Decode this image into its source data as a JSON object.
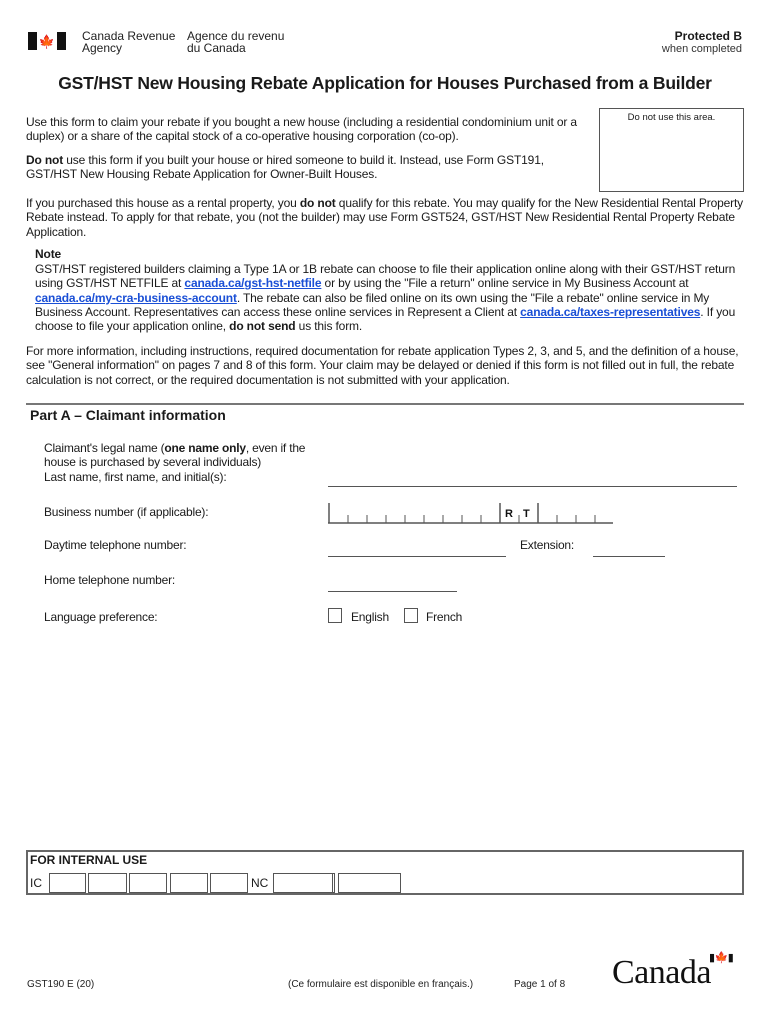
{
  "header": {
    "agency_en_line1": "Canada Revenue",
    "agency_en_line2": "Agency",
    "agency_fr_line1": "Agence du revenu",
    "agency_fr_line2": "du Canada",
    "flag_icon": "canada-flag-icon",
    "protected_label": "Protected B",
    "protected_sub": "when completed"
  },
  "title": "GST/HST New Housing Rebate Application for Houses Purchased from a Builder",
  "do_not_use_area": "Do not use this area.",
  "intro": {
    "p1": "Use this form to claim your rebate if you bought a new house (including a residential condominium unit or a duplex) or a share of the capital stock of a co-operative housing corporation (co-op).",
    "p2_bold": "Do not",
    "p2_rest": " use this form if you built your house or hired someone to build it. Instead, use Form GST191, GST/HST New Housing Rebate Application for Owner-Built Houses.",
    "p3_a": "If you purchased this house as a rental property, you ",
    "p3_bold": "do not",
    "p3_b": " qualify for this rebate. You may qualify for the New Residential Rental Property Rebate instead. To apply for that rebate, you (not the builder) may use Form GST524, GST/HST New Residential Rental Property Rebate Application."
  },
  "note": {
    "heading": "Note",
    "t1": "GST/HST registered builders claiming a Type 1A or 1B rebate can choose to file their application online along with their GST/HST return using GST/HST NETFILE at ",
    "link1": "canada.ca/gst-hst-netfile",
    "t2": " or by using the \"File a return\" online service in My Business Account at ",
    "link2": "canada.ca/my-cra-business-account",
    "t3": ". The rebate can also be filed online on its own using the \"File a rebate\" online service in My Business Account. Representatives can access these online services in Represent a Client at ",
    "link3": "canada.ca/taxes-representatives",
    "t4": ". If you choose to file your application online, ",
    "t4_bold": "do not send",
    "t5": " us this form."
  },
  "more_info": "For more information, including instructions, required documentation for rebate application Types 2, 3, and 5, and the definition of a house, see \"General information\" on pages 7 and 8 of this form. Your claim may be delayed or denied if this form is not filled out in full, the rebate calculation is not correct, or the required documentation is not submitted with your application.",
  "partA": {
    "heading": "Part A – Claimant information",
    "legal_name_a": "Claimant's legal name (",
    "legal_name_bold": "one name only",
    "legal_name_b": ", even if the house is purchased by several individuals)",
    "legal_name_c": "Last name, first name, and initial(s):",
    "legal_name_value": "",
    "business_number_label": "Business number (if applicable):",
    "bn_prefix": [
      "",
      "",
      "",
      "",
      "",
      "",
      "",
      "",
      ""
    ],
    "bn_rt": "R T",
    "bn_suffix": [
      "",
      "",
      "",
      ""
    ],
    "daytime_phone_label": "Daytime telephone number:",
    "daytime_phone_value": "",
    "extension_label": "Extension:",
    "extension_value": "",
    "home_phone_label": "Home telephone number:",
    "home_phone_value": "",
    "language_label": "Language preference:",
    "language_options": [
      "English",
      "French"
    ],
    "language_selected": ""
  },
  "internal_use": {
    "heading": "FOR INTERNAL USE",
    "ic_label": "IC",
    "nc_label": "NC"
  },
  "footer": {
    "form_code": "GST190 E (20)",
    "french_note": "(Ce formulaire est disponible en français.)",
    "page": "Page 1 of 8",
    "wordmark": "Canada"
  }
}
